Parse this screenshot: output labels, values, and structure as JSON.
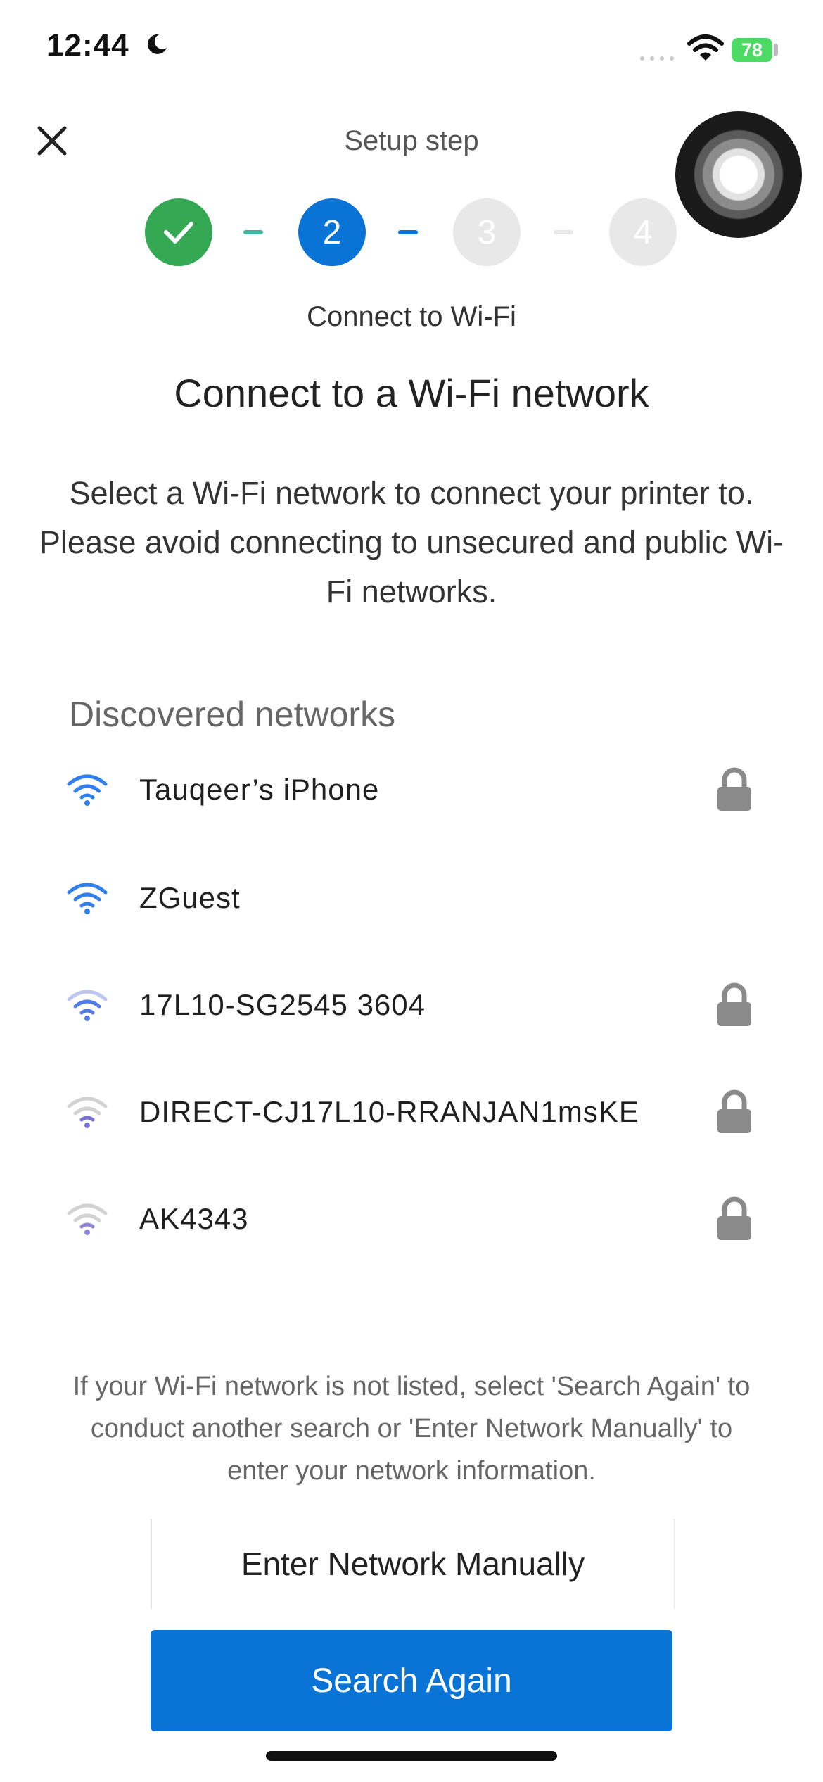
{
  "status_bar": {
    "time": "12:44",
    "battery": "78",
    "battery_color": "#4cd964"
  },
  "header": {
    "title": "Setup step",
    "close_icon": "close-icon"
  },
  "stepper": {
    "steps": [
      {
        "label": "",
        "state": "done"
      },
      {
        "label": "2",
        "state": "active"
      },
      {
        "label": "3",
        "state": "todo"
      },
      {
        "label": "4",
        "state": "todo"
      }
    ],
    "current_label": "Connect to Wi-Fi",
    "done_color": "#34a853",
    "active_color": "#0a74d6"
  },
  "main": {
    "title": "Connect to a Wi-Fi network",
    "instructions": "Select a Wi-Fi network to connect your printer to. Please avoid connecting to unsecured and public Wi-Fi networks."
  },
  "networks": {
    "section_title": "Discovered networks",
    "items": [
      {
        "name": "Tauqeer’s iPhone",
        "locked": true,
        "strength": 3
      },
      {
        "name": "ZGuest",
        "locked": false,
        "strength": 3
      },
      {
        "name": "17L10-SG2545 3604",
        "locked": true,
        "strength": 2
      },
      {
        "name": "DIRECT-CJ17L10-RRANJAN1msKE",
        "locked": true,
        "strength": 1
      },
      {
        "name": "AK4343",
        "locked": true,
        "strength": 1
      }
    ]
  },
  "help_text": "If your Wi-Fi network is not listed, select 'Search Again' to conduct another search or 'Enter Network Manually' to enter your network information.",
  "buttons": {
    "manual": "Enter Network Manually",
    "search": "Search Again",
    "primary_color": "#0a74d6"
  }
}
